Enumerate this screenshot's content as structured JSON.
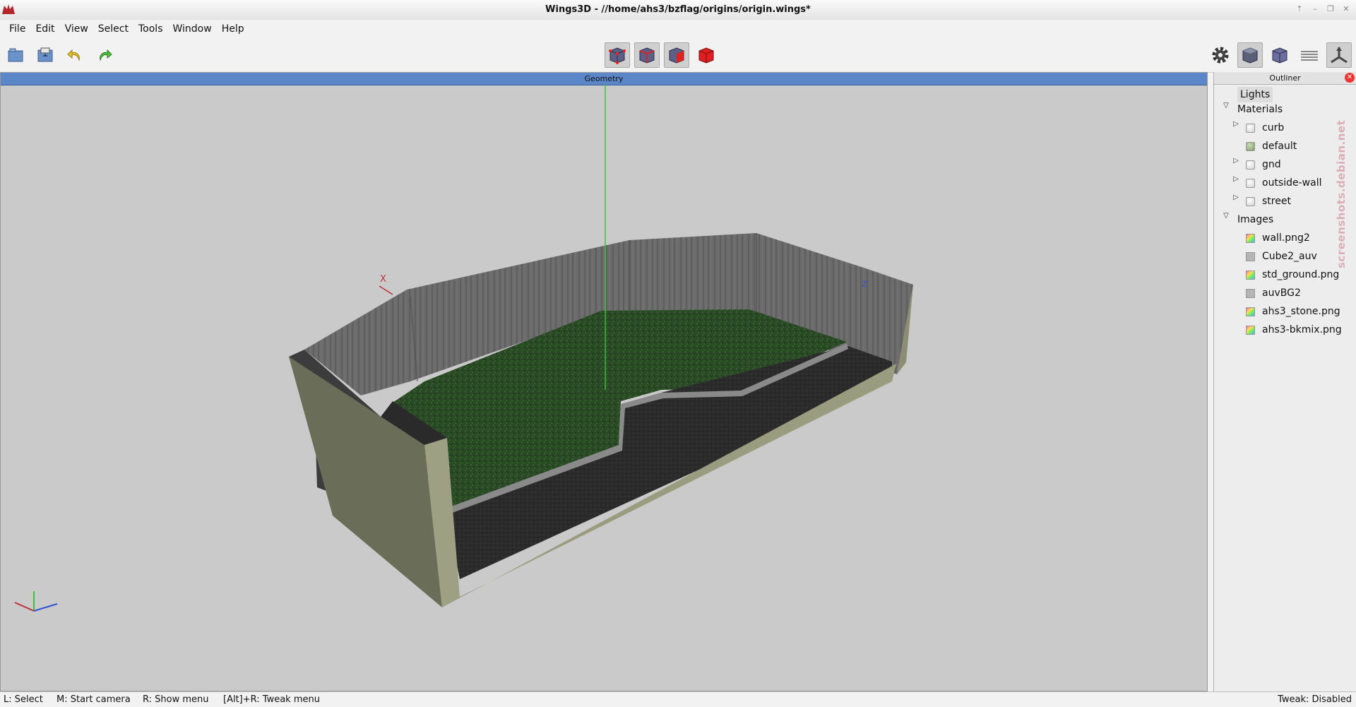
{
  "window": {
    "title": "Wings3D - //home/ahs3/bzflag/origins/origin.wings*",
    "controls": [
      "up-icon",
      "minimize-icon",
      "restore-icon",
      "close-icon"
    ]
  },
  "menu": [
    "File",
    "Edit",
    "View",
    "Select",
    "Tools",
    "Window",
    "Help"
  ],
  "toolbar": {
    "left_icons": [
      "open-icon",
      "save-icon",
      "undo-icon",
      "redo-icon"
    ],
    "select_modes": [
      "vertex-mode-icon",
      "edge-mode-icon",
      "face-mode-icon",
      "body-mode-icon"
    ],
    "right_icons": [
      "gear-icon",
      "smooth-cube-icon",
      "wire-cube-icon",
      "ground-icon",
      "axes-icon"
    ]
  },
  "viewport": {
    "header": "Geometry",
    "axis_labels": {
      "x": "X",
      "z": "Z"
    },
    "colors": {
      "background": "#cacaca",
      "header": "#5b87c8",
      "x_axis": "#c0303a",
      "y_axis": "#3fbe3f",
      "z_axis": "#2f55d4"
    }
  },
  "outliner": {
    "header": "Outliner",
    "lights": "Lights",
    "materials_label": "Materials",
    "materials": [
      {
        "name": "curb",
        "expandable": true
      },
      {
        "name": "default",
        "expandable": false
      },
      {
        "name": "gnd",
        "expandable": true
      },
      {
        "name": "outside-wall",
        "expandable": true
      },
      {
        "name": "street",
        "expandable": true
      }
    ],
    "images_label": "Images",
    "images": [
      "wall.png2",
      "Cube2_auv",
      "std_ground.png",
      "auvBG2",
      "ahs3_stone.png",
      "ahs3-bkmix.png"
    ]
  },
  "watermark": "screenshots.debian.net",
  "status": {
    "left": [
      "L: Select",
      "M: Start camera",
      "R: Show menu",
      "[Alt]+R: Tweak menu"
    ],
    "right": "Tweak: Disabled"
  }
}
